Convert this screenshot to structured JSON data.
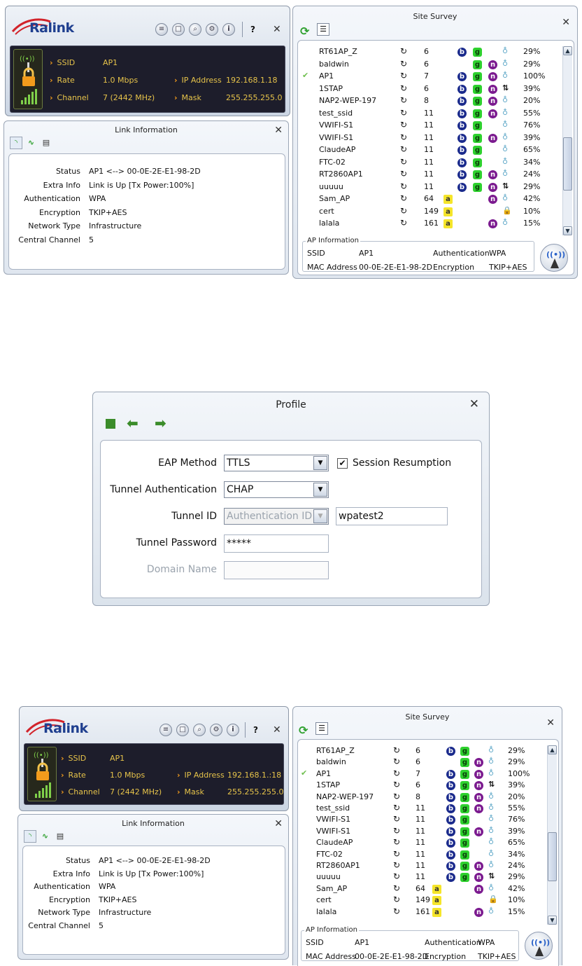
{
  "brand": {
    "logo_text": "Ralink",
    "accent": "#1f3f8f",
    "status_text_color": "#e6c34a",
    "arrow_color": "#f29b1c"
  },
  "toolbar": {
    "icons": [
      "list-icon",
      "profile-icon",
      "search-icon",
      "settings-icon",
      "info-icon"
    ],
    "help_label": "?",
    "close_label": "✕"
  },
  "status_panel": {
    "ssid_label": "SSID",
    "ssid_value": "AP1",
    "rate_label": "Rate",
    "rate_value": "1.0 Mbps",
    "channel_label": "Channel",
    "channel_value": "7 (2442 MHz)",
    "ip_label": "IP Address",
    "ip_value": "192.168.1.18",
    "ip_value_bottom": "192.168.1.:18",
    "mask_label": "Mask",
    "mask_value": "255.255.255.0"
  },
  "link_info": {
    "title": "Link Information",
    "close_label": "✕",
    "tab_icons": [
      "signal-icon",
      "graph-icon",
      "document-icon"
    ],
    "rows": [
      {
        "label": "Status",
        "value": "AP1 <--> 00-0E-2E-E1-98-2D"
      },
      {
        "label": "Extra Info",
        "value": "Link is Up  [Tx Power:100%]"
      },
      {
        "label": "Authentication",
        "value": "WPA"
      },
      {
        "label": "Encryption",
        "value": "TKIP+AES"
      },
      {
        "label": "Network Type",
        "value": "Infrastructure"
      },
      {
        "label": "Central Channel",
        "value": "5"
      }
    ]
  },
  "site_survey": {
    "title": "Site Survey",
    "close_label": "✕",
    "rows": [
      {
        "ssid": "RT61AP_Z",
        "channel": "6",
        "b": true,
        "g": true,
        "n": false,
        "wps": "",
        "signal": "29%",
        "connected": false,
        "lock": false
      },
      {
        "ssid": "baldwin",
        "channel": "6",
        "b": false,
        "g": true,
        "n": true,
        "wps": "",
        "signal": "29%",
        "connected": false,
        "lock": false
      },
      {
        "ssid": "AP1",
        "channel": "7",
        "b": true,
        "g": true,
        "n": true,
        "wps": "",
        "signal": "100%",
        "connected": true,
        "lock": false
      },
      {
        "ssid": "1STAP",
        "channel": "6",
        "b": true,
        "g": true,
        "n": true,
        "wps": "⇅",
        "signal": "39%",
        "connected": false,
        "lock": false
      },
      {
        "ssid": "NAP2-WEP-197",
        "channel": "8",
        "b": true,
        "g": true,
        "n": true,
        "wps": "",
        "signal": "20%",
        "connected": false,
        "lock": false
      },
      {
        "ssid": "test_ssid",
        "channel": "11",
        "b": true,
        "g": true,
        "n": true,
        "wps": "",
        "signal": "55%",
        "connected": false,
        "lock": false
      },
      {
        "ssid": "VWIFI-S1",
        "channel": "11",
        "b": true,
        "g": true,
        "n": false,
        "wps": "",
        "signal": "76%",
        "connected": false,
        "lock": false
      },
      {
        "ssid": "VWIFI-S1",
        "channel": "11",
        "b": true,
        "g": true,
        "n": true,
        "wps": "",
        "signal": "39%",
        "connected": false,
        "lock": false
      },
      {
        "ssid": "ClaudeAP",
        "channel": "11",
        "b": true,
        "g": true,
        "n": false,
        "wps": "",
        "signal": "65%",
        "connected": false,
        "lock": false
      },
      {
        "ssid": "FTC-02",
        "channel": "11",
        "b": true,
        "g": true,
        "n": false,
        "wps": "",
        "signal": "34%",
        "connected": false,
        "lock": false
      },
      {
        "ssid": "RT2860AP1",
        "channel": "11",
        "b": true,
        "g": true,
        "n": true,
        "wps": "",
        "signal": "24%",
        "connected": false,
        "lock": false
      },
      {
        "ssid": "uuuuu",
        "channel": "11",
        "b": true,
        "g": true,
        "n": true,
        "wps": "⇅",
        "signal": "29%",
        "connected": false,
        "lock": false
      },
      {
        "ssid": "Sam_AP",
        "channel": "64",
        "a": true,
        "b": false,
        "g": false,
        "n": true,
        "wps": "",
        "signal": "42%",
        "connected": false,
        "lock": false
      },
      {
        "ssid": "cert",
        "channel": "149",
        "a": true,
        "b": false,
        "g": false,
        "n": false,
        "wps": "",
        "signal": "10%",
        "connected": false,
        "lock": true
      },
      {
        "ssid": "lalala",
        "channel": "161",
        "a": true,
        "b": false,
        "g": false,
        "n": true,
        "wps": "",
        "signal": "15%",
        "connected": false,
        "lock": false
      }
    ],
    "ap_info": {
      "title": "AP Information",
      "ssid_label": "SSID",
      "ssid_value": "AP1",
      "auth_label": "Authentication",
      "auth_value": "WPA",
      "mac_label": "MAC Address",
      "mac_value": "00-0E-2E-E1-98-2D",
      "enc_label": "Encryption",
      "enc_value": "TKIP+AES"
    }
  },
  "profile": {
    "title": "Profile",
    "close_label": "✕",
    "eap_label": "EAP Method",
    "eap_value": "TTLS",
    "session_resumption_label": "Session Resumption",
    "tunnel_auth_label": "Tunnel Authentication",
    "tunnel_auth_value": "CHAP",
    "tunnel_id_label": "Tunnel ID",
    "tunnel_id_select": "Authentication ID",
    "tunnel_id_value": "wpatest2",
    "tunnel_password_label": "Tunnel Password",
    "tunnel_password_value": "*****",
    "domain_name_label": "Domain Name"
  }
}
